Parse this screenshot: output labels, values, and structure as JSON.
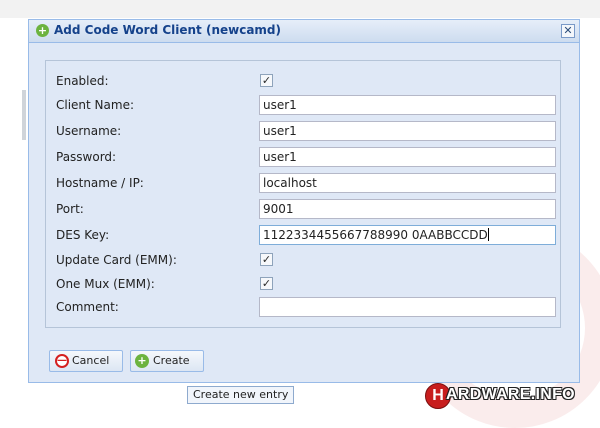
{
  "dialog": {
    "title": "Add Code Word Client (newcamd)",
    "close_glyph": "✕"
  },
  "form": {
    "enabled": {
      "label": "Enabled:",
      "checked": true
    },
    "client_name": {
      "label": "Client Name:",
      "value": "user1"
    },
    "username": {
      "label": "Username:",
      "value": "user1"
    },
    "password": {
      "label": "Password:",
      "value": "user1"
    },
    "hostname": {
      "label": "Hostname / IP:",
      "value": "localhost"
    },
    "port": {
      "label": "Port:",
      "value": "9001"
    },
    "des_key": {
      "label": "DES Key:",
      "value": "1122334455667788990 0AABBCCDD"
    },
    "update_card": {
      "label": "Update Card (EMM):",
      "checked": true
    },
    "one_mux": {
      "label": "One Mux (EMM):",
      "checked": true
    },
    "comment": {
      "label": "Comment:",
      "value": ""
    }
  },
  "buttons": {
    "cancel": "Cancel",
    "create": "Create"
  },
  "tooltip": "Create new entry",
  "logo": {
    "letter": "H",
    "text": "ARDWARE.INFO"
  },
  "icons": {
    "title": "add-circle-icon",
    "cancel": "no-entry-icon",
    "create": "add-circle-icon",
    "checkmark": "✓"
  },
  "colors": {
    "accent": "#15428b",
    "border": "#99bbe8",
    "panel": "#dfe8f6",
    "logo_red": "#c81e1e"
  }
}
